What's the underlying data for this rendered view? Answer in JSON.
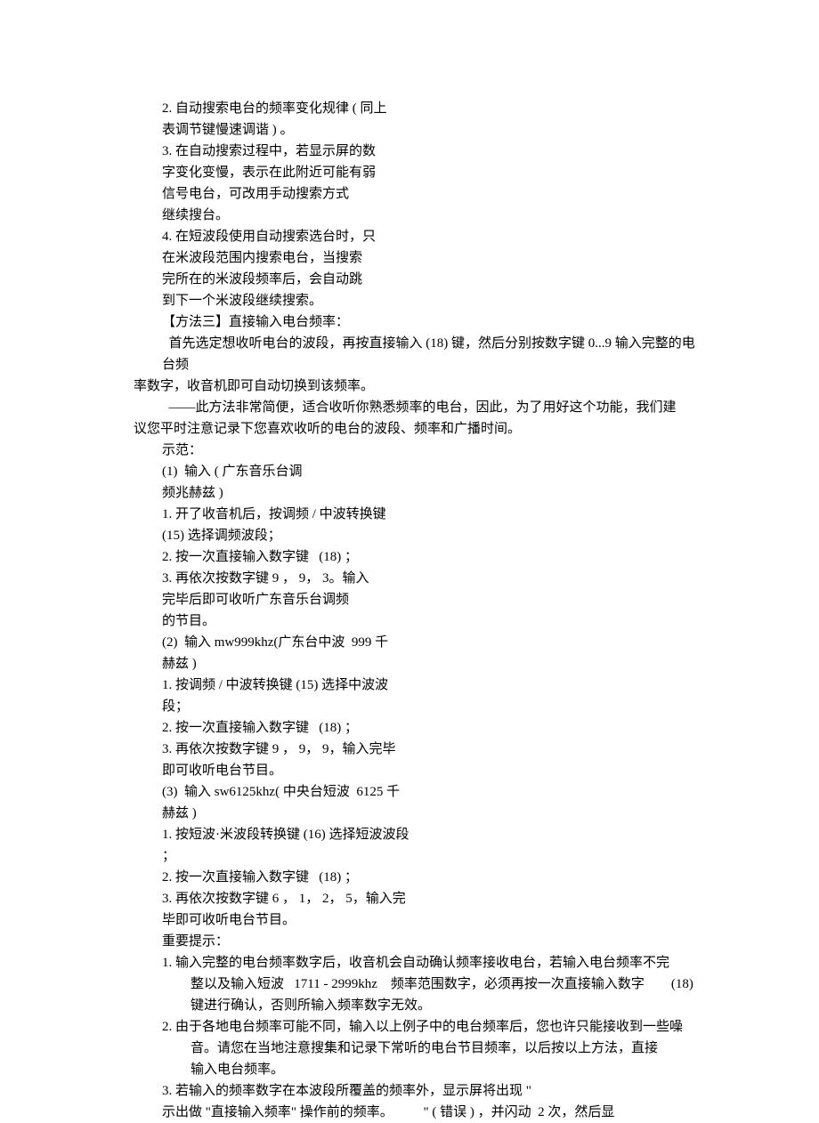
{
  "lines": [
    {
      "cls": "indent1",
      "text": "2. 自动搜索电台的频率变化规律 ( 同上"
    },
    {
      "cls": "indent1",
      "text": "表调节键慢速调谐 ) 。"
    },
    {
      "cls": "indent1",
      "text": "3. 在自动搜索过程中，若显示屏的数"
    },
    {
      "cls": "indent1",
      "text": "字变化变慢，表示在此附近可能有弱"
    },
    {
      "cls": "indent1",
      "text": "信号电台，可改用手动搜索方式"
    },
    {
      "cls": "indent1",
      "text": "继续搜台。"
    },
    {
      "cls": "indent1",
      "text": "4. 在短波段使用自动搜索选台时，只"
    },
    {
      "cls": "indent1",
      "text": "在米波段范围内搜索电台，当搜索"
    },
    {
      "cls": "indent1",
      "text": "完所在的米波段频率后，会自动跳"
    },
    {
      "cls": "indent1",
      "text": "到下一个米波段继续搜索。"
    },
    {
      "cls": "indent1",
      "text": "【方法三】直接输入电台频率："
    },
    {
      "cls": "indent1",
      "text": "  首先选定想收听电台的波段，再按直接输入 (18) 键，然后分别按数字键 0...9 输入完整的电台频"
    },
    {
      "cls": "flush",
      "text": "率数字，收音机即可自动切换到该频率。"
    },
    {
      "cls": "indent1",
      "text": "  ——此方法非常简便，适合收听你熟悉频率的电台，因此，为了用好这个功能，我们建"
    },
    {
      "cls": "flush",
      "text": "议您平时注意记录下您喜欢收听的电台的波段、频率和广播时间。"
    },
    {
      "cls": "indent1",
      "text": "示范："
    },
    {
      "cls": "indent1",
      "text": "(1)  输入 ( 广东音乐台调"
    },
    {
      "cls": "indent1",
      "text": "频兆赫兹 )"
    },
    {
      "cls": "indent1",
      "text": "1. 开了收音机后，按调频 / 中波转换键"
    },
    {
      "cls": "indent1",
      "text": "(15) 选择调频波段；"
    },
    {
      "cls": "indent1",
      "text": "2. 按一次直接输入数字键   (18) ；"
    },
    {
      "cls": "indent1",
      "text": "3. 再依次按数字键 9 ， 9， 3。输入"
    },
    {
      "cls": "indent1",
      "text": "完毕后即可收听广东音乐台调频"
    },
    {
      "cls": "indent1",
      "text": "的节目。"
    },
    {
      "cls": "indent1",
      "text": "(2)  输入 mw999khz(广东台中波  999 千"
    },
    {
      "cls": "indent1",
      "text": "赫兹 )"
    },
    {
      "cls": "indent1",
      "text": "1. 按调频 / 中波转换键 (15) 选择中波波"
    },
    {
      "cls": "indent1",
      "text": "段；"
    },
    {
      "cls": "indent1",
      "text": "2. 按一次直接输入数字键   (18) ；"
    },
    {
      "cls": "indent1",
      "text": "3. 再依次按数字键 9 ， 9， 9，输入完毕"
    },
    {
      "cls": "indent1",
      "text": "即可收听电台节目。"
    },
    {
      "cls": "indent1",
      "text": "(3)  输入 sw6125khz( 中央台短波  6125 千"
    },
    {
      "cls": "indent1",
      "text": "赫兹 )"
    },
    {
      "cls": "indent1",
      "text": "1. 按短波·米波段转换键 (16) 选择短波波段"
    },
    {
      "cls": "indent1",
      "text": "；"
    },
    {
      "cls": "indent1",
      "text": "2. 按一次直接输入数字键   (18) ；"
    },
    {
      "cls": "indent1",
      "text": "3. 再依次按数字键 6 ， 1， 2， 5，输入完"
    },
    {
      "cls": "indent1",
      "text": "毕即可收听电台节目。"
    },
    {
      "cls": "indent1",
      "text": "重要提示："
    },
    {
      "cls": "indent1",
      "text": "1. 输入完整的电台频率数字后，收音机会自动确认频率接收电台，若输入电台频率不完"
    },
    {
      "cls": "indent2",
      "text": "整以及输入短波   1711 - 2999khz    频率范围数字，必须再按一次直接输入数字        (18)"
    },
    {
      "cls": "indent2",
      "text": "键进行确认，否则所输入频率数字无效。"
    },
    {
      "cls": "indent1",
      "text": "2. 由于各地电台频率可能不同，输入以上例子中的电台频率后，您也许只能接收到一些噪"
    },
    {
      "cls": "indent2",
      "text": "音。请您在当地注意搜集和记录下常听的电台节目频率，以后按以上方法，直接"
    },
    {
      "cls": "indent2",
      "text": "输入电台频率。"
    },
    {
      "cls": "indent1",
      "text": "3. 若输入的频率数字在本波段所覆盖的频率外，显示屏将出现 \""
    },
    {
      "cls": "indent1",
      "text": "示出做 \"直接输入频率\" 操作前的频率。         \" ( 错误 ) ，并闪动  2 次，然后显"
    }
  ]
}
